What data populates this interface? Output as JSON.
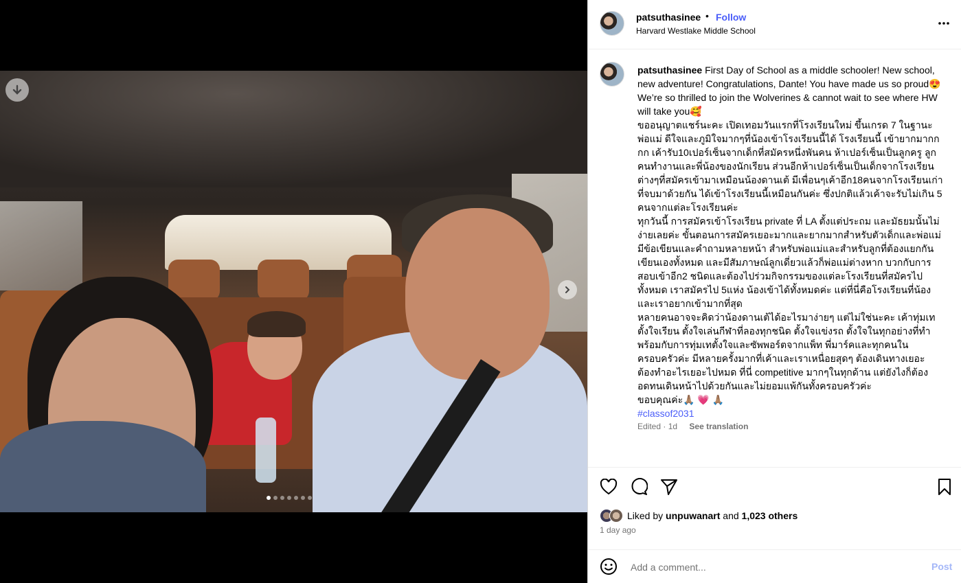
{
  "post": {
    "username": "patsuthasinee",
    "separator": "•",
    "follow_label": "Follow",
    "location": "Harvard Westlake Middle School",
    "more_label": "•••"
  },
  "media": {
    "download_icon": "download-arrow-icon",
    "next_icon": "chevron-right-icon",
    "dots": [
      true,
      false,
      false,
      false,
      false,
      false,
      false
    ]
  },
  "caption": {
    "username": "patsuthasinee",
    "paragraphs": [
      "First Day of School as a middle schooler! New school, new adventure! Congratulations, Dante! You have made us so proud😍 We’re so thrilled to join the Wolverines & cannot wait to see where HW will take you🥰",
      "ขออนุญาตแชร์นะคะ เปิดเทอมวันแรกที่โรงเรียนใหม่ ขึ้นเกรด 7 ในฐานะพ่อแม่ ดีใจและภูมิใจมากๆที่น้องเข้าโรงเรียนนี้ได้ โรงเรียนนี้ เข้ายากมากกกก เค้ารับ10เปอร์เซ็นจากเด็กที่สมัครหนึ่งพันคน ห้าเปอร์เซ็นเป็นลูกครู ลูกคนทำงานและพี่น้องของนักเรียน ส่วนอีกห้าเปอร์เซ็นเป็นเด็กจากโรงเรียนต่างๆที่สมัครเข้ามาเหมือนน้องดานเต้ มีเพื่อนๆเค้าอีก18คนจากโรงเรียนเก่าที่จบมาด้วยกัน ได้เข้าโรงเรียนนี้เหมือนกันค่ะ ซึ่งปกติแล้วเค้าจะรับไม่เกิน 5 คนจากแต่ละโรงเรียนค่ะ",
      "ทุกวันนี้ การสมัครเข้าโรงเรียน private ที่ LA ตั้งแต่ประถม และมัธยมนั้นไม่ง่ายเลยค่ะ ขั้นตอนการสมัครเยอะมากและยากมากสำหรับตัวเด็กและพ่อแม่ มีข้อเขียนและคำถามหลายหน้า สำหรับพ่อแม่และสำหรับลูกที่ต้องแยกกันเขียนเองทั้งหมด และมีสัมภาษณ์ลูกเดี่ยวแล้วก็พ่อแม่ต่างหาก บวกกับการสอบเข้าอีก2 ชนิดและต้องไปร่วมกิจกรรมของแต่ละโรงเรียนที่สมัครไปทั้งหมด เราสมัครไป 5แห่ง น้องเข้าได้ทั้งหมดค่ะ แต่ที่นี่คือโรงเรียนที่น้องและเราอยากเข้ามากที่สุด",
      "หลายคนอาจจะคิดว่าน้องดานเต้ได้อะไรมาง่ายๆ แต่ไม่ใช่นะคะ เค้าทุ่มเท ตั้งใจเรียน ตั้งใจเล่นกีฬาที่ลองทุกชนิด ตั้งใจแข่งรถ ตั้งใจในทุกอย่างที่ทำ พร้อมกับการทุ่มเทตั้งใจและซัพพอร์ตจากแพ็ท พี่มาร์คและทุกคนในครอบครัวค่ะ มีหลายครั้งมากที่เค้าและเราเหนื่อยสุดๆ ต้องเดินทางเยอะ ต้องทำอะไรเยอะไปหมด ที่นี่ competitive มากๆในทุกด้าน แต่ยังไงก็ต้องอดทนเดินหน้าไปด้วยกันและไม่ยอมแพ้กันทั้งครอบครัวค่ะ",
      "ขอบคุณค่ะ🙏🏽 💗 🙏🏽"
    ],
    "hashtag": "#classof2031",
    "edited": "Edited · 1d",
    "see_translation": "See translation"
  },
  "actions": {
    "like_icon": "heart-icon",
    "comment_icon": "comment-bubble-icon",
    "share_icon": "paper-plane-icon",
    "save_icon": "bookmark-icon"
  },
  "likes": {
    "prefix": "Liked by ",
    "user": "unpuwanart",
    "middle": " and ",
    "others": "1,023 others"
  },
  "time": "1 day ago",
  "comment_box": {
    "placeholder": "Add a comment...",
    "post_label": "Post",
    "emoji_icon": "smiley-icon"
  },
  "colors": {
    "link": "#4a5df9",
    "muted": "#737373",
    "post_disabled": "#a4b7f8"
  }
}
